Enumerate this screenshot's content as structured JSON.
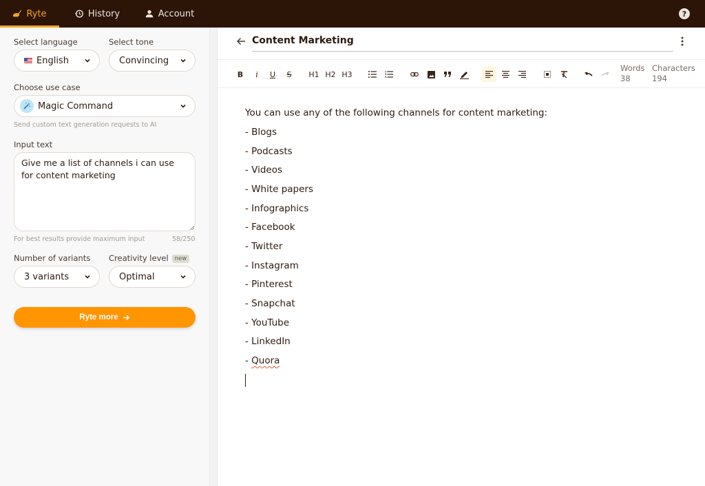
{
  "nav": {
    "items": [
      {
        "label": "Ryte",
        "icon": "writing-hand-icon",
        "active": true
      },
      {
        "label": "History",
        "icon": "history-icon",
        "active": false
      },
      {
        "label": "Account",
        "icon": "user-icon",
        "active": false
      }
    ],
    "help_icon": "help-icon"
  },
  "sidebar": {
    "language": {
      "label": "Select language",
      "value": "English",
      "icon": "us-flag-icon"
    },
    "tone": {
      "label": "Select tone",
      "value": "Convincing"
    },
    "use_case": {
      "label": "Choose use case",
      "value": "Magic Command",
      "icon": "magic-wand-icon",
      "hint": "Send custom text generation requests to AI"
    },
    "input": {
      "label": "Input text",
      "value": "Give me a list of channels i can use for content marketing",
      "hint": "For best results provide maximum input",
      "counter": "58/250"
    },
    "variants": {
      "label": "Number of variants",
      "value": "3 variants"
    },
    "creativity": {
      "label": "Creativity level",
      "badge": "new",
      "value": "Optimal"
    },
    "submit_label": "Ryte more"
  },
  "editor": {
    "title": "Content Marketing",
    "toolbar": {
      "bold": "B",
      "italic": "i",
      "underline": "U",
      "strike": "S",
      "h1": "H1",
      "h2": "H2",
      "h3": "H3",
      "words_label": "Words",
      "words_value": "38",
      "chars_label": "Characters",
      "chars_value": "194"
    },
    "content": {
      "intro": "You can use any of the following channels for content marketing:",
      "items": [
        "- Blogs",
        "- Podcasts",
        "- Videos",
        "- White papers",
        "- Infographics",
        "- Facebook",
        "- Twitter",
        "- Instagram",
        "- Pinterest",
        "- Snapchat",
        "- YouTube",
        "- LinkedIn"
      ],
      "last_prefix": "- ",
      "last_word": "Quora"
    }
  },
  "colors": {
    "nav_bg": "#2c1406",
    "accent": "#f5a623",
    "button": "#ff9500",
    "text": "#2d1a0e"
  }
}
